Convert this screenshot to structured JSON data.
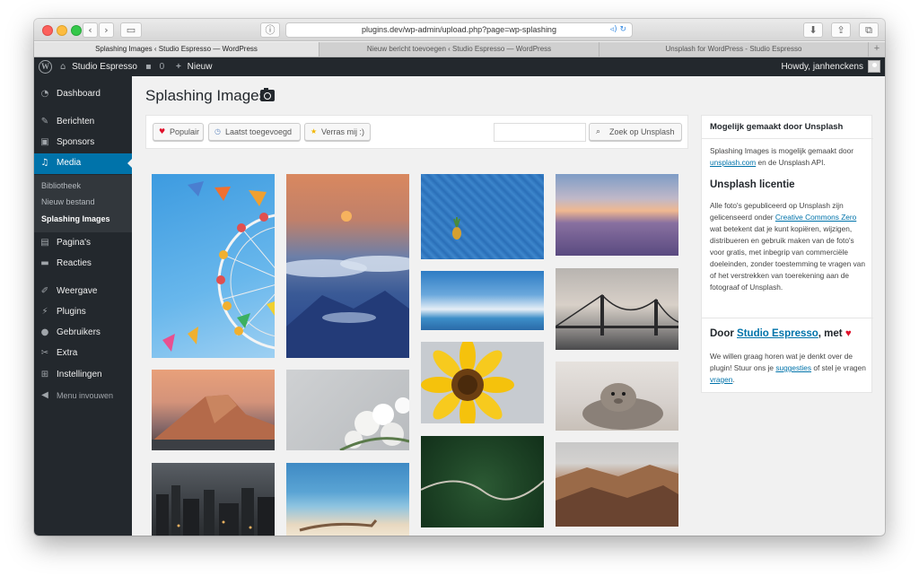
{
  "browser": {
    "url": "plugins.dev/wp-admin/upload.php?page=wp-splashing",
    "tabs": [
      "Splashing Images ‹ Studio Espresso — WordPress",
      "Nieuw bericht toevoegen ‹ Studio Espresso — WordPress",
      "Unsplash for WordPress - Studio Espresso"
    ]
  },
  "adminbar": {
    "site_name": "Studio Espresso",
    "comments_count": "0",
    "new_label": "Nieuw",
    "howdy": "Howdy, janhenckens"
  },
  "sidebar": {
    "items": [
      {
        "label": "Dashboard",
        "icon": "dashboard-icon"
      },
      {
        "label": "Berichten",
        "icon": "pin-icon"
      },
      {
        "label": "Sponsors",
        "icon": "image-icon"
      },
      {
        "label": "Media",
        "icon": "media-icon"
      },
      {
        "label": "Pagina's",
        "icon": "page-icon"
      },
      {
        "label": "Reacties",
        "icon": "comment-icon"
      },
      {
        "label": "Weergave",
        "icon": "brush-icon"
      },
      {
        "label": "Plugins",
        "icon": "plug-icon"
      },
      {
        "label": "Gebruikers",
        "icon": "user-icon"
      },
      {
        "label": "Extra",
        "icon": "wrench-icon"
      },
      {
        "label": "Instellingen",
        "icon": "settings-icon"
      },
      {
        "label": "Menu invouwen",
        "icon": "collapse-icon"
      }
    ],
    "submenu": [
      "Bibliotheek",
      "Nieuw bestand",
      "Splashing Images"
    ]
  },
  "main": {
    "title": "Splashing Images",
    "filters": {
      "popular": "Populair",
      "latest": "Laatst toegevoegd",
      "random": "Verras mij :)"
    },
    "search_button": "Zoek op Unsplash"
  },
  "panel": {
    "powered_title": "Mogelijk gemaakt door Unsplash",
    "powered_text_1": "Splashing Images is mogelijk gemaakt door",
    "powered_link": "unsplash.com",
    "powered_text_2": "en de Unsplash API.",
    "license_title": "Unsplash licentie",
    "license_text_1": "Alle foto's gepubliceerd op Unsplash zijn gelicenseerd onder",
    "license_link": "Creative Commons Zero",
    "license_text_2": "wat betekent dat je kunt kopiëren, wijzigen, distribueren en gebruik maken van de foto's voor gratis, met inbegrip van commerciële doeleinden, zonder toestemming te vragen van of het verstrekken van toerekening aan de fotograaf of Unsplash.",
    "by_prefix": "Door",
    "by_link": "Studio Espresso",
    "by_suffix": ", met",
    "feedback_1": "We willen graag horen wat je denkt over de plugin! Stuur ons je",
    "feedback_link_1": "suggesties",
    "feedback_2": "of stel je vragen",
    "feedback_link_2": "vragen",
    "feedback_3": "."
  },
  "colors": {
    "wp_dark": "#23282d",
    "wp_blue": "#0073aa",
    "heart": "#e0112b"
  }
}
